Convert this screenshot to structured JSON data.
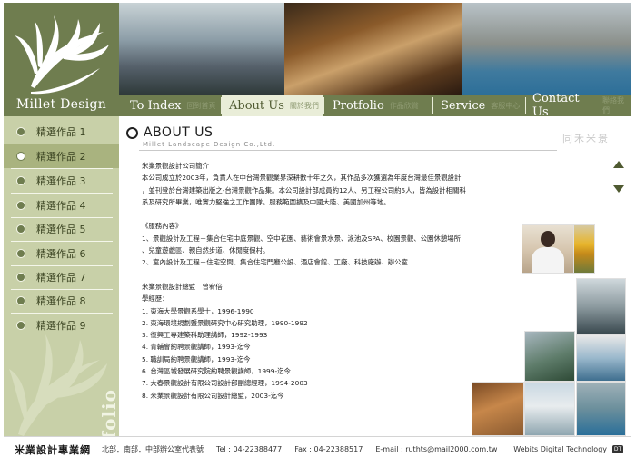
{
  "logo": {
    "text": "Millet Design"
  },
  "nav": {
    "items": [
      {
        "en": "To Index",
        "cn": "回到首頁"
      },
      {
        "en": "About Us",
        "cn": "關於我們"
      },
      {
        "en": "Protfolio",
        "cn": "作品欣賞"
      },
      {
        "en": "Service",
        "cn": "客服中心"
      },
      {
        "en": "Contact Us",
        "cn": "聯絡我們"
      }
    ]
  },
  "sidebar": {
    "items": [
      {
        "label": "精選作品 1"
      },
      {
        "label": "精選作品 2"
      },
      {
        "label": "精選作品 3"
      },
      {
        "label": "精選作品 4"
      },
      {
        "label": "精選作品 5"
      },
      {
        "label": "精選作品 6"
      },
      {
        "label": "精選作品 7"
      },
      {
        "label": "精選作品 8"
      },
      {
        "label": "精選作品 9"
      }
    ],
    "vertical_text": "Protfolio"
  },
  "content": {
    "title": "ABOUT US",
    "subtitle": "Millet Landscape Design Co.,Ltd.",
    "stamp": "同禾米景",
    "lines": [
      "米業景觀設計公司簡介",
      "本公司成立於2003年，負責人在中台灣景觀業界深耕數十年之久，其作品多次獲選為年度台灣最佳景觀設計",
      "，並刊登於台灣建築出版之-台灣景觀作品集。本公司設計部成員約12人、另工程公司約5人，皆為設計相關科",
      "系及研究所畢業，唯實力堅強之工作團隊。服務範圍擴及中國大陸、美國加州等地。",
      "",
      "《服務內容》",
      "1、景觀設計及工程－集合住宅中庭景觀、空中花園、藝術會景水景、泳池及SPA、校園景觀、公園休憩場所",
      "、兒童遊戲區、親自然步道、休閒度假村。",
      "2、室內設計及工程－住宅空間、集合住宅門廳公設、酒店會館、工廠、科技廠辦、辦公室",
      "",
      "米業景觀設計總監　曾宥倍",
      "學經歷：",
      "1. 東海大學景觀系學士，1996-1990",
      "2. 東海環境規劃暨景觀研究中心研究助理，1990-1992",
      "3. 復興工專建築科助理講師，1992-1993",
      "4. 青輔會約聘景觀講師，1993-迄今",
      "5. 職訓局約聘景觀講師，1993-迄今",
      "6. 台灣區城發展研究院約聘景觀講師，1999-迄今",
      "7. 大春景觀設計有限公司設計部副總經理，1994-2003",
      "8. 米業景觀設計有限公司設計總監，2003-迄今"
    ]
  },
  "footer": {
    "brand": "米業設計專業網",
    "offices": "北部．南部．中部辦公室代表號",
    "tel": "Tel : 04-22388477",
    "fax": "Fax : 04-22388517",
    "email": "E-mail : ruthts@mail2000.com.tw",
    "credit": "Webits Digital Technology",
    "credit_badge": "DT"
  },
  "colors": {
    "brand_green": "#6f7d4f",
    "sidebar_bg": "#c8d0a8",
    "sidebar_active": "#a9b37f",
    "nav_active": "#e9edd8"
  }
}
